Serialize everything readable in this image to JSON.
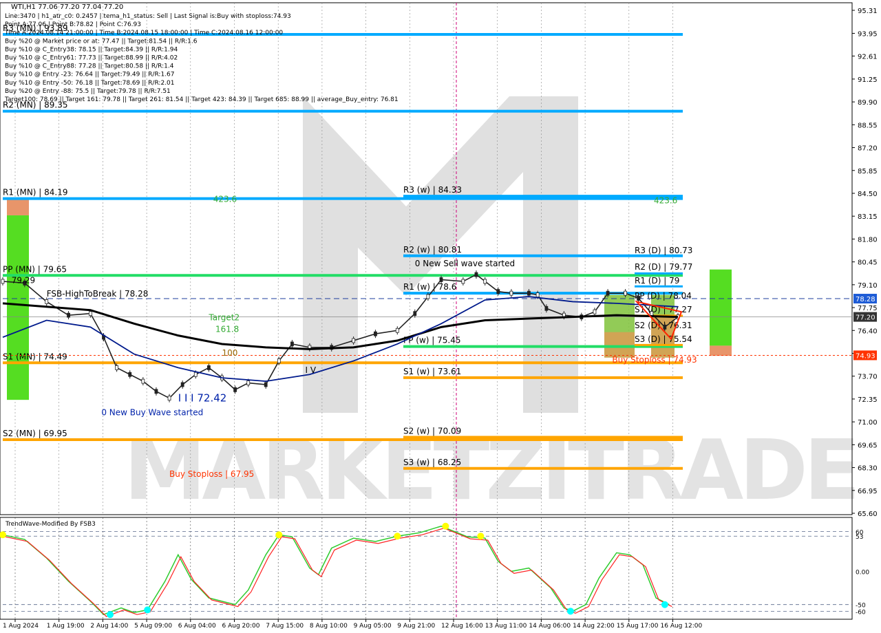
{
  "header": {
    "symbol_line": "WTI,H1  77.06 77.20 77.04 77.20",
    "info_lines": [
      "Line:3470  |  h1_atr_c0: 0.2457  |  tema_h1_status: Sell  |  Last Signal is:Buy with stoploss:74.93",
      "Point A:77.06  |  Point B:78.82  |  Point C:76.93",
      "Time A:2024.08.14 21:00:00  |  Time B:2024.08.15 18:00:00  |  Time C:2024.08.16 12:00:00",
      "Buy %20 @ Market price or at: 77.47  ||  Target:81.54  ||  R/R:1.6",
      "Buy %10 @ C_Entry38: 78.15  ||  Target:84.39  ||  R/R:1.94",
      "Buy %10 @ C_Entry61: 77.73  ||  Target:88.99  ||  R/R:4.02",
      "Buy %10 @ C_Entry88: 77.28  ||  Target:80.58  ||  R/R:1.4",
      "Buy %10 @ Entry -23: 76.64  ||  Target:79.49  ||  R/R:1.67",
      "Buy %10 @ Entry -50: 76.18  ||  Target:78.69  ||  R/R:2.01",
      "Buy %20 @ Entry -88: 75.5  ||  Target:79.78  ||  R/R:7.51",
      "Target100: 78.69  ||  Target 161: 79.78  ||  Target 261: 81.54  ||  Target 423: 84.39  ||  Target 685: 88.99  ||  average_Buy_entry: 76.81"
    ]
  },
  "colors": {
    "monthly_level": "#00aaff",
    "pp_level": "#22dd66",
    "support_level": "#ffa500",
    "ma_black": "#000000",
    "ma_navy": "#001a8c",
    "price_marker_blue": "#1e5cd6",
    "price_marker_gray": "#333333",
    "stoploss_red": "#ff3300",
    "osc_green": "#2ecc2e",
    "osc_red": "#ff2222",
    "osc_dot_yellow": "#ffff00",
    "osc_dot_cyan": "#00ffff"
  },
  "chart_data": [
    {
      "type": "candlestick",
      "ylim": [
        65.6,
        95.31
      ],
      "y_ticks": [
        "95.31",
        "93.95",
        "92.61",
        "91.25",
        "89.90",
        "88.55",
        "87.20",
        "85.85",
        "84.50",
        "83.15",
        "81.80",
        "80.45",
        "79.10",
        "77.75",
        "76.40",
        "75.05",
        "73.70",
        "72.35",
        "71.00",
        "69.65",
        "68.30",
        "66.95",
        "65.60"
      ],
      "x_ticks": [
        "1 Aug 2024",
        "1 Aug 19:00",
        "2 Aug 14:00",
        "5 Aug 09:00",
        "6 Aug 04:00",
        "6 Aug 20:00",
        "7 Aug 15:00",
        "8 Aug 10:00",
        "9 Aug 05:00",
        "9 Aug 21:00",
        "12 Aug 16:00",
        "13 Aug 11:00",
        "14 Aug 06:00",
        "14 Aug 22:00",
        "15 Aug 17:00",
        "16 Aug 12:00"
      ],
      "close_path": [
        [
          0,
          79.3
        ],
        [
          0.5,
          79.2
        ],
        [
          1,
          78.1
        ],
        [
          1.5,
          77.3
        ],
        [
          2,
          77.4
        ],
        [
          2.3,
          76.0
        ],
        [
          2.6,
          74.2
        ],
        [
          2.9,
          73.8
        ],
        [
          3.2,
          73.4
        ],
        [
          3.5,
          72.8
        ],
        [
          3.8,
          72.4
        ],
        [
          4.1,
          73.2
        ],
        [
          4.4,
          73.8
        ],
        [
          4.7,
          74.2
        ],
        [
          5.0,
          73.6
        ],
        [
          5.3,
          72.9
        ],
        [
          5.6,
          73.3
        ],
        [
          6.0,
          73.2
        ],
        [
          6.3,
          74.6
        ],
        [
          6.6,
          75.6
        ],
        [
          7.0,
          75.4
        ],
        [
          7.5,
          75.4
        ],
        [
          8.0,
          75.8
        ],
        [
          8.5,
          76.2
        ],
        [
          9.0,
          76.4
        ],
        [
          9.4,
          77.4
        ],
        [
          9.7,
          78.4
        ],
        [
          10.0,
          79.4
        ],
        [
          10.5,
          79.3
        ],
        [
          10.8,
          79.7
        ],
        [
          11.0,
          79.3
        ],
        [
          11.3,
          78.7
        ],
        [
          11.6,
          78.6
        ],
        [
          12.0,
          78.6
        ],
        [
          12.2,
          78.5
        ],
        [
          12.4,
          77.7
        ],
        [
          12.8,
          77.3
        ],
        [
          13.2,
          77.2
        ],
        [
          13.5,
          77.5
        ],
        [
          13.8,
          78.6
        ],
        [
          14.2,
          78.6
        ],
        [
          14.5,
          78.3
        ],
        [
          14.8,
          77.4
        ],
        [
          15.1,
          76.6
        ],
        [
          15.4,
          77.2
        ]
      ],
      "current_price": 77.2,
      "levels": [
        {
          "label": "R3 (MN) | 93.89",
          "value": 93.89,
          "x_from": 0,
          "x_to": 15.0,
          "color": "#00aaff"
        },
        {
          "label": "R2 (MN) | 89.35",
          "value": 89.35,
          "x_from": 0,
          "x_to": 15.0,
          "color": "#00aaff"
        },
        {
          "label": "R1 (MN) | 84.19",
          "value": 84.19,
          "x_from": 0,
          "x_to": 15.0,
          "color": "#00aaff"
        },
        {
          "label": "PP (MN) | 79.65",
          "value": 79.65,
          "x_from": 0,
          "x_to": 15.0,
          "color": "#22dd66"
        },
        {
          "label": "S1 (MN) | 74.49",
          "value": 74.49,
          "x_from": 0,
          "x_to": 15.0,
          "color": "#ffa500"
        },
        {
          "label": "S2 (MN) | 69.95",
          "value": 69.95,
          "x_from": 0,
          "x_to": 15.0,
          "color": "#ffa500"
        },
        {
          "label": "R3 (w) | 84.33",
          "value": 84.33,
          "x_from": 9.0,
          "x_to": 15.0,
          "color": "#00aaff"
        },
        {
          "label": "R2 (w) | 80.81",
          "value": 80.81,
          "x_from": 9.0,
          "x_to": 15.0,
          "color": "#00aaff"
        },
        {
          "label": "R1 (w) | 78.6",
          "value": 78.6,
          "x_from": 9.0,
          "x_to": 15.0,
          "color": "#00aaff"
        },
        {
          "label": "PP (w) | 75.45",
          "value": 75.45,
          "x_from": 9.0,
          "x_to": 15.0,
          "color": "#22dd66"
        },
        {
          "label": "S1 (w) | 73.61",
          "value": 73.61,
          "x_from": 9.0,
          "x_to": 15.0,
          "color": "#ffa500"
        },
        {
          "label": "S2 (w) | 70.09",
          "value": 70.09,
          "x_from": 9.0,
          "x_to": 15.0,
          "color": "#ffa500"
        },
        {
          "label": "S3 (w) | 68.25",
          "value": 68.25,
          "x_from": 9.0,
          "x_to": 15.0,
          "color": "#ffa500"
        }
      ],
      "daily_labels": [
        {
          "label": "R3 (D) | 80.73",
          "value": 80.73
        },
        {
          "label": "R2 (D) | 79.77",
          "value": 79.77
        },
        {
          "label": "R1 (D) | 79",
          "value": 79.0
        },
        {
          "label": "PP (D) | 78.04",
          "value": 78.04
        },
        {
          "label": "S1 (D) | 77.27",
          "value": 77.27
        },
        {
          "label": "S2 (D) | 76.31",
          "value": 76.31
        },
        {
          "label": "S3 (D) | 75.54",
          "value": 75.54
        }
      ],
      "annotations": [
        {
          "text": "0 New Sell wave started",
          "x": 9.4,
          "y": 80.2
        },
        {
          "text": "0 New Buy Wave started",
          "x": 2.25,
          "y": 71.4
        },
        {
          "text": "I I I 72.42",
          "x": 4.0,
          "y": 72.2
        },
        {
          "text": "Target2",
          "x": 4.7,
          "y": 77.0
        },
        {
          "text": "161.8",
          "x": 4.85,
          "y": 76.3
        },
        {
          "text": "100",
          "x": 5.0,
          "y": 74.9
        },
        {
          "text": "423.6",
          "x": 4.8,
          "y": 84.0
        },
        {
          "text": "423.6",
          "x": 14.85,
          "y": 83.9
        },
        {
          "text": "Buy Stoploss | 67.95",
          "x": 3.8,
          "y": 67.75
        },
        {
          "text": "Buy Stoploss | 74.93",
          "x": 13.9,
          "y": 74.5
        },
        {
          "text": "FSB-HighToBreak | 78.28",
          "x": 1.0,
          "y": 78.4
        },
        {
          "text": "79.29",
          "x": 0.2,
          "y": 79.2
        },
        {
          "text": "I V",
          "x": 6.9,
          "y": 73.9
        }
      ],
      "price_tags": [
        {
          "value": 78.28,
          "text": "78.28"
        },
        {
          "value": 77.2,
          "text": "77.20"
        },
        {
          "value": 74.93,
          "text": "74.93"
        }
      ]
    },
    {
      "type": "line",
      "title": "TrendWave-Modified By FSB3",
      "ylim": [
        -70,
        75
      ],
      "y_ticks": [
        "60",
        "53",
        "0.00",
        "-50",
        "-60"
      ],
      "series": [
        {
          "values": [
            [
              0,
              55
            ],
            [
              0.5,
              48
            ],
            [
              1,
              20
            ],
            [
              1.5,
              -15
            ],
            [
              2,
              -45
            ],
            [
              2.3,
              -65
            ],
            [
              2.7,
              -55
            ],
            [
              3.0,
              -62
            ],
            [
              3.3,
              -58
            ],
            [
              3.7,
              -15
            ],
            [
              4.0,
              25
            ],
            [
              4.3,
              -12
            ],
            [
              4.7,
              -40
            ],
            [
              5.0,
              -45
            ],
            [
              5.3,
              -50
            ],
            [
              5.6,
              -28
            ],
            [
              6.0,
              25
            ],
            [
              6.3,
              55
            ],
            [
              6.6,
              52
            ],
            [
              7.0,
              5
            ],
            [
              7.2,
              -5
            ],
            [
              7.5,
              35
            ],
            [
              8.0,
              50
            ],
            [
              8.5,
              45
            ],
            [
              9.0,
              53
            ],
            [
              9.5,
              58
            ],
            [
              10.0,
              68
            ],
            [
              10.3,
              60
            ],
            [
              10.6,
              52
            ],
            [
              11.0,
              50
            ],
            [
              11.3,
              15
            ],
            [
              11.6,
              0
            ],
            [
              12.0,
              5
            ],
            [
              12.5,
              -25
            ],
            [
              12.8,
              -55
            ],
            [
              13.0,
              -60
            ],
            [
              13.3,
              -50
            ],
            [
              13.6,
              -10
            ],
            [
              14.0,
              28
            ],
            [
              14.3,
              25
            ],
            [
              14.6,
              10
            ],
            [
              14.9,
              -40
            ],
            [
              15.2,
              -50
            ]
          ]
        }
      ],
      "markers_yellow": [
        [
          0,
          55
        ],
        [
          6.3,
          55
        ],
        [
          9.0,
          53
        ],
        [
          10.1,
          68
        ],
        [
          10.9,
          53
        ]
      ],
      "markers_cyan": [
        [
          2.45,
          -65
        ],
        [
          3.3,
          -58
        ],
        [
          12.95,
          -60
        ],
        [
          15.1,
          -50
        ]
      ]
    }
  ],
  "watermark": "MARKETZITRADE"
}
